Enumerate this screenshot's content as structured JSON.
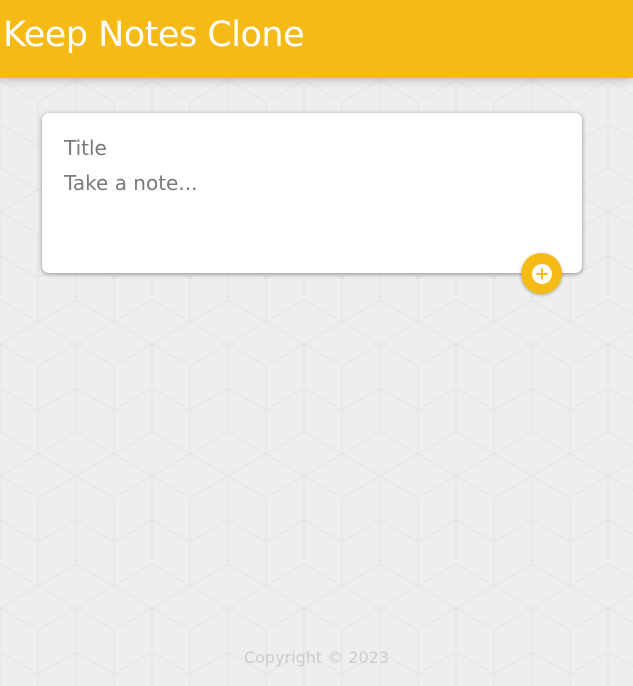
{
  "header": {
    "title": "Keep Notes Clone"
  },
  "note_form": {
    "title_placeholder": "Title",
    "content_placeholder": "Take a note...",
    "add_button_icon": "plus-circle-icon"
  },
  "footer": {
    "copyright": "Copyright © 2023"
  },
  "colors": {
    "accent": "#f5ba13",
    "background": "#eeeeee",
    "footer_text": "#cccccc"
  }
}
